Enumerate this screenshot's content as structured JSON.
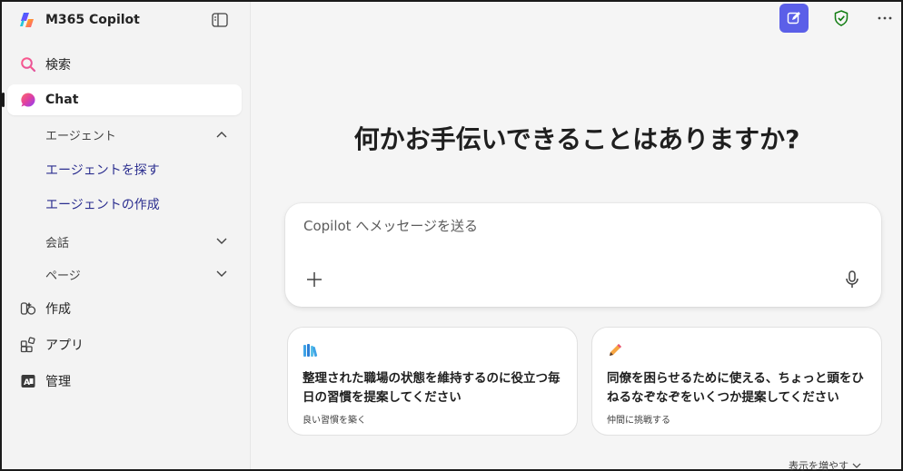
{
  "app": {
    "title": "M365 Copilot"
  },
  "sidebar": {
    "search": {
      "label": "検索",
      "icon": "search-icon"
    },
    "chat": {
      "label": "Chat",
      "icon": "chat-icon"
    },
    "agents": {
      "header": "エージェント",
      "items": [
        {
          "label": "エージェントを探す"
        },
        {
          "label": "エージェントの作成"
        }
      ]
    },
    "conversations": {
      "header": "会話"
    },
    "pages": {
      "header": "ページ"
    },
    "create": {
      "label": "作成",
      "icon": "create-icon"
    },
    "apps": {
      "label": "アプリ",
      "icon": "apps-icon"
    },
    "admin": {
      "label": "管理",
      "icon": "admin-icon"
    }
  },
  "main": {
    "headline": "何かお手伝いできることはありますか?",
    "composer": {
      "placeholder": "Copilot へメッセージを送る"
    },
    "cards": [
      {
        "icon": "books-icon",
        "title": "整理された職場の状態を維持するのに役立つ毎日の習慣を提案してください",
        "subtitle": "良い習慣を築く"
      },
      {
        "icon": "pencil-icon",
        "title": "同僚を困らせるために使える、ちょっと頭をひねるなぞなぞをいくつか提案してください",
        "subtitle": "仲間に挑戦する"
      }
    ],
    "show_more": "表示を増やす"
  },
  "colors": {
    "accent": "#5b5fe8",
    "link": "#2b2e8f",
    "shield": "#107c10"
  }
}
